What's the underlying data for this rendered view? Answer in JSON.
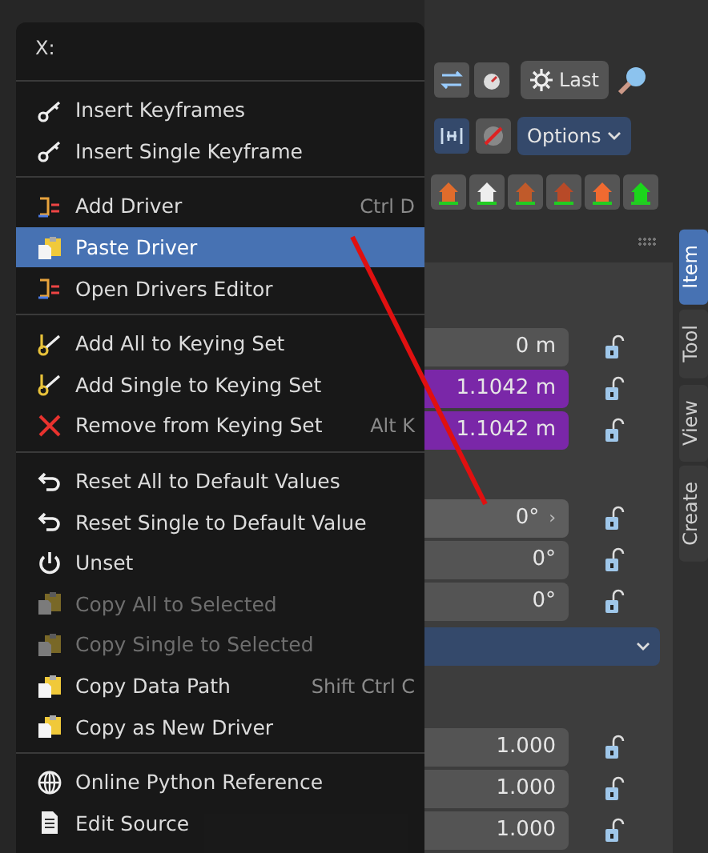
{
  "menu": {
    "title": "X:",
    "sections": [
      [
        {
          "kind": "keyframe",
          "label": "Insert Keyframes",
          "selected": false,
          "disabled": false
        },
        {
          "kind": "keyframe",
          "label": "Insert Single Keyframe",
          "selected": false,
          "disabled": false
        }
      ],
      [
        {
          "kind": "driver",
          "label": "Add Driver",
          "shortcut": "Ctrl D",
          "selected": false,
          "disabled": false
        },
        {
          "kind": "clipboard",
          "label": "Paste Driver",
          "selected": true,
          "disabled": false
        },
        {
          "kind": "driver",
          "label": "Open Drivers Editor",
          "selected": false,
          "disabled": false
        }
      ],
      [
        {
          "kind": "keyingset",
          "label": "Add All to Keying Set",
          "selected": false,
          "disabled": false
        },
        {
          "kind": "keyingset",
          "label": "Add Single to Keying Set",
          "selected": false,
          "disabled": false
        },
        {
          "kind": "remove",
          "label": "Remove from Keying Set",
          "shortcut": "Alt K",
          "selected": false,
          "disabled": false
        }
      ],
      [
        {
          "kind": "reset",
          "label": "Reset All to Default Values",
          "selected": false,
          "disabled": false
        },
        {
          "kind": "reset",
          "label": "Reset Single to Default Value",
          "selected": false,
          "disabled": false
        },
        {
          "kind": "unset",
          "label": "Unset",
          "selected": false,
          "disabled": false
        },
        {
          "kind": "clipboard",
          "label": "Copy All to Selected",
          "selected": false,
          "disabled": true
        },
        {
          "kind": "clipboard",
          "label": "Copy Single to Selected",
          "selected": false,
          "disabled": true
        },
        {
          "kind": "clipboard",
          "label": "Copy Data Path",
          "shortcut": "Shift Ctrl C",
          "selected": false,
          "disabled": false
        },
        {
          "kind": "clipboard",
          "label": "Copy as New Driver",
          "selected": false,
          "disabled": false
        }
      ],
      [
        {
          "kind": "web",
          "label": "Online Python Reference",
          "selected": false,
          "disabled": false
        },
        {
          "kind": "document",
          "label": "Edit Source",
          "selected": false,
          "disabled": false
        }
      ]
    ]
  },
  "toolbar": {
    "last_button": "Last",
    "options_button": "Options"
  },
  "panel": {
    "tabs": [
      {
        "label": "Item",
        "selected": true
      },
      {
        "label": "Tool",
        "selected": false
      },
      {
        "label": "View",
        "selected": false
      },
      {
        "label": "Create",
        "selected": false
      }
    ],
    "location": [
      {
        "value": "0 m",
        "keyed": false
      },
      {
        "value": "1.1042 m",
        "keyed": true
      },
      {
        "value": "1.1042 m",
        "keyed": true
      }
    ],
    "rotation": [
      {
        "value": "0°",
        "keyed": false,
        "arrow": "›"
      },
      {
        "value": "0°",
        "keyed": false
      },
      {
        "value": "0°",
        "keyed": false
      }
    ],
    "scale": [
      {
        "value": "1.000",
        "keyed": false
      },
      {
        "value": "1.000",
        "keyed": false
      },
      {
        "value": "1.000",
        "keyed": false
      }
    ]
  }
}
